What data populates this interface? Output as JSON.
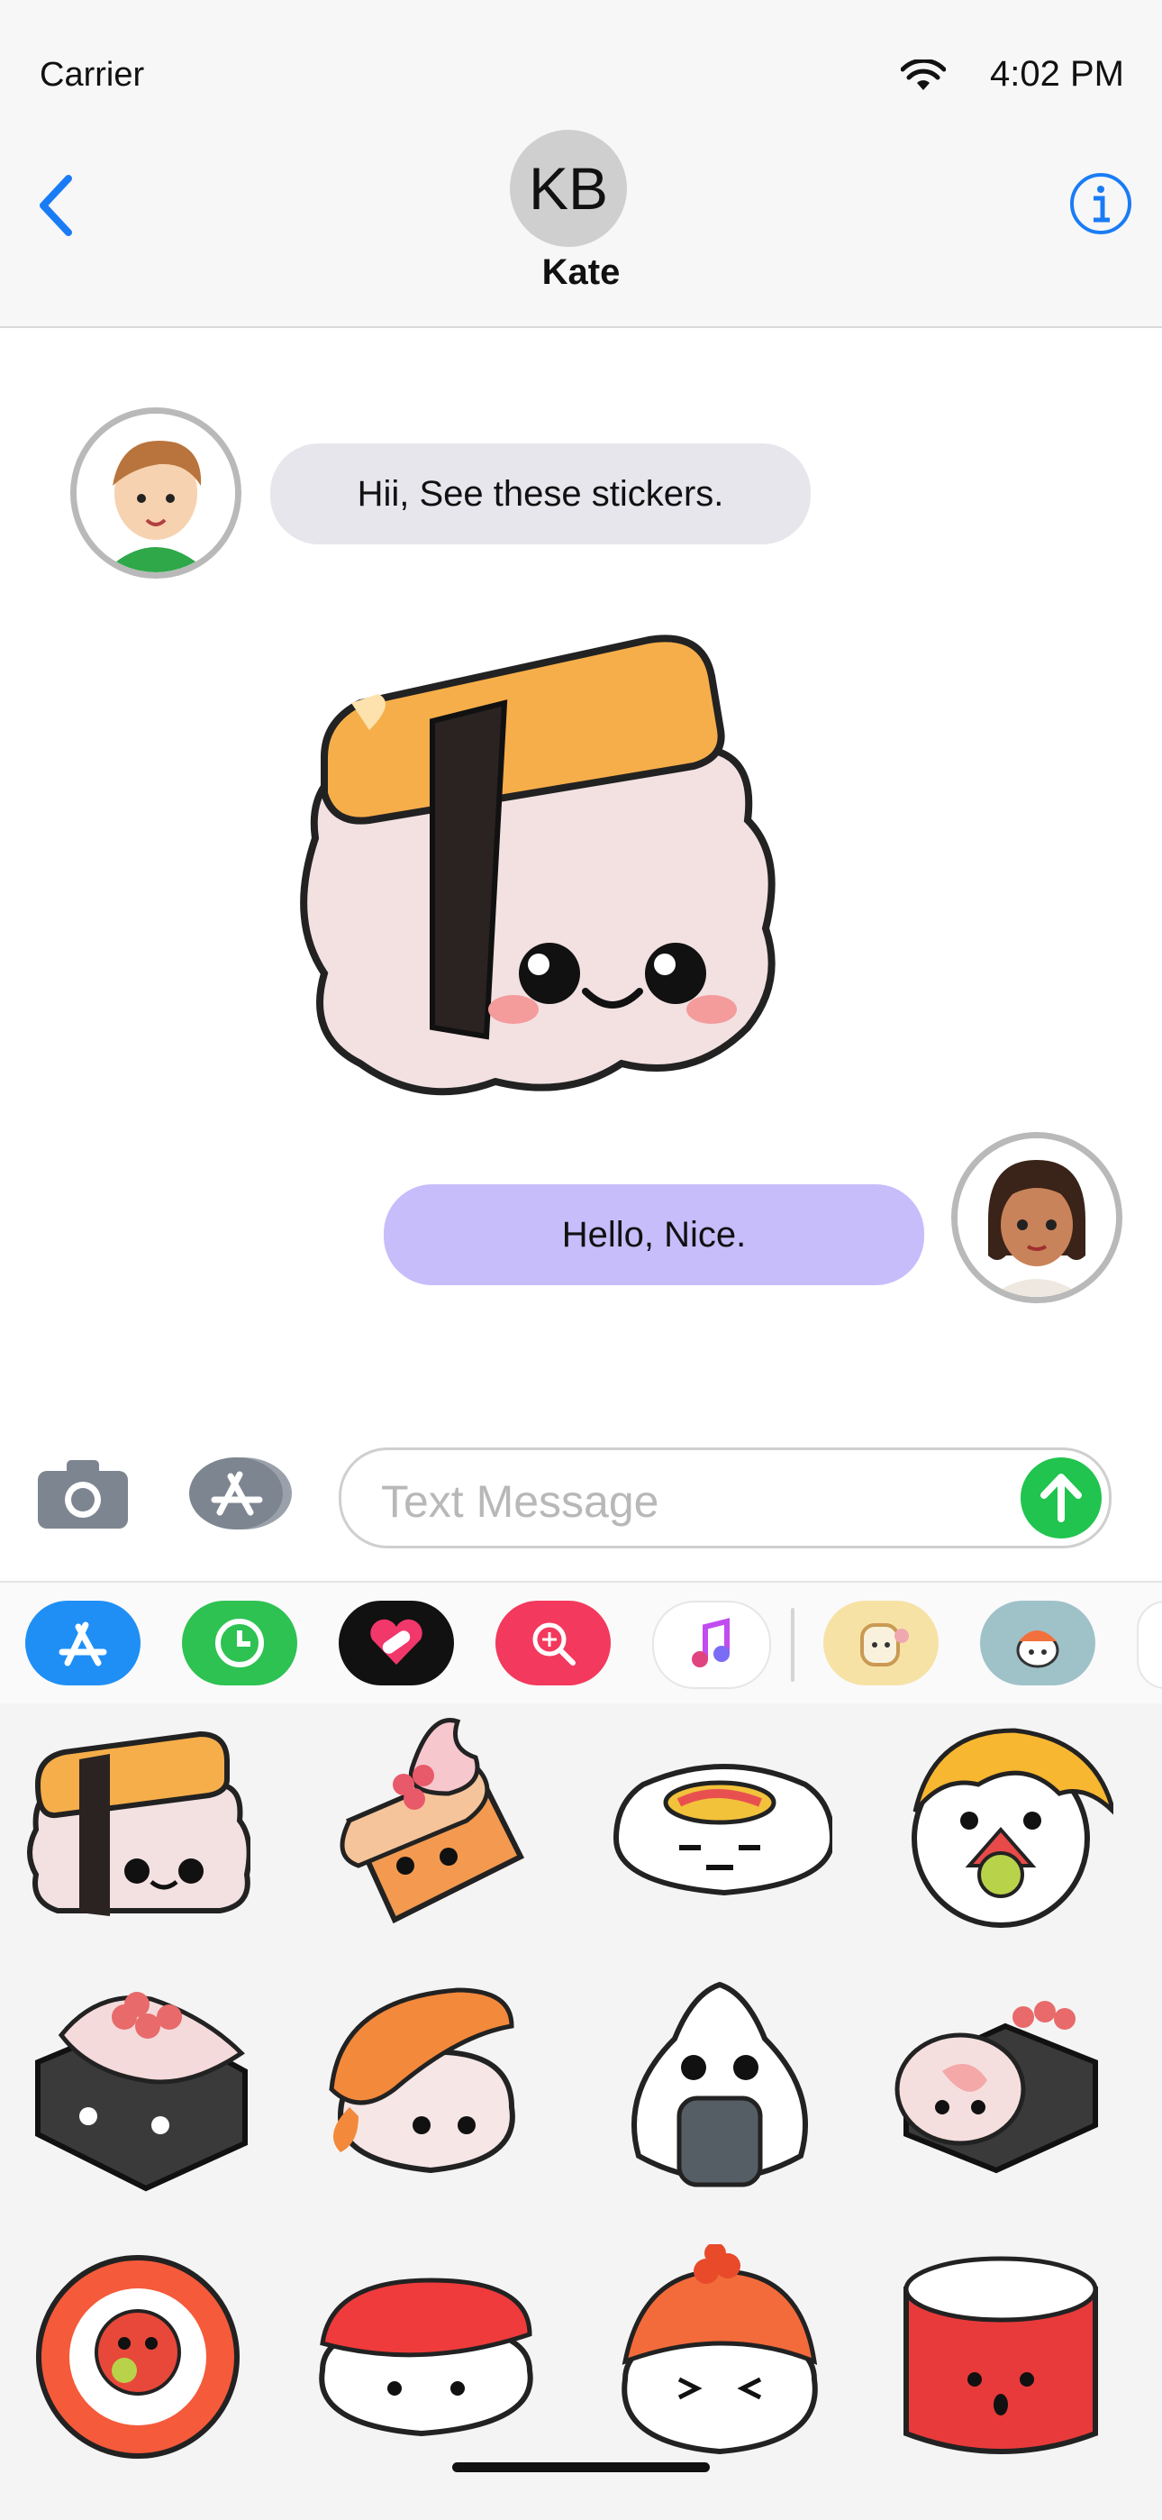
{
  "status_bar": {
    "carrier": "Carrier",
    "time": "4:02 PM"
  },
  "header": {
    "contact_initials": "KB",
    "contact_name": "Kate"
  },
  "messages": [
    {
      "direction": "incoming",
      "text": "Hii, See these stickers."
    },
    {
      "direction": "outgoing",
      "text": "Hello, Nice."
    }
  ],
  "compose": {
    "placeholder": "Text Message"
  },
  "app_strip": {
    "items": [
      "app-store",
      "digital-touch-clock",
      "heart-bandage",
      "image-search",
      "music",
      "bread-sticker-pack",
      "sushi-sticker-pack"
    ]
  },
  "sticker_grid": {
    "stickers": [
      "tamago-nigiri",
      "salmon-roll-cream",
      "maki-roll-grumpy",
      "maki-roll-yellow-hair",
      "gunkan-roe",
      "shrimp-nigiri",
      "onigiri",
      "roll-side",
      "salmon-roll-slice",
      "tuna-nigiri",
      "roe-nigiri-laughing",
      "tuna-roll-surprised"
    ]
  },
  "colors": {
    "accent": "#1a7cf5",
    "outgoing_bubble": "#c7bdfb",
    "incoming_bubble": "#e6e6ec",
    "send": "#20c44e"
  }
}
